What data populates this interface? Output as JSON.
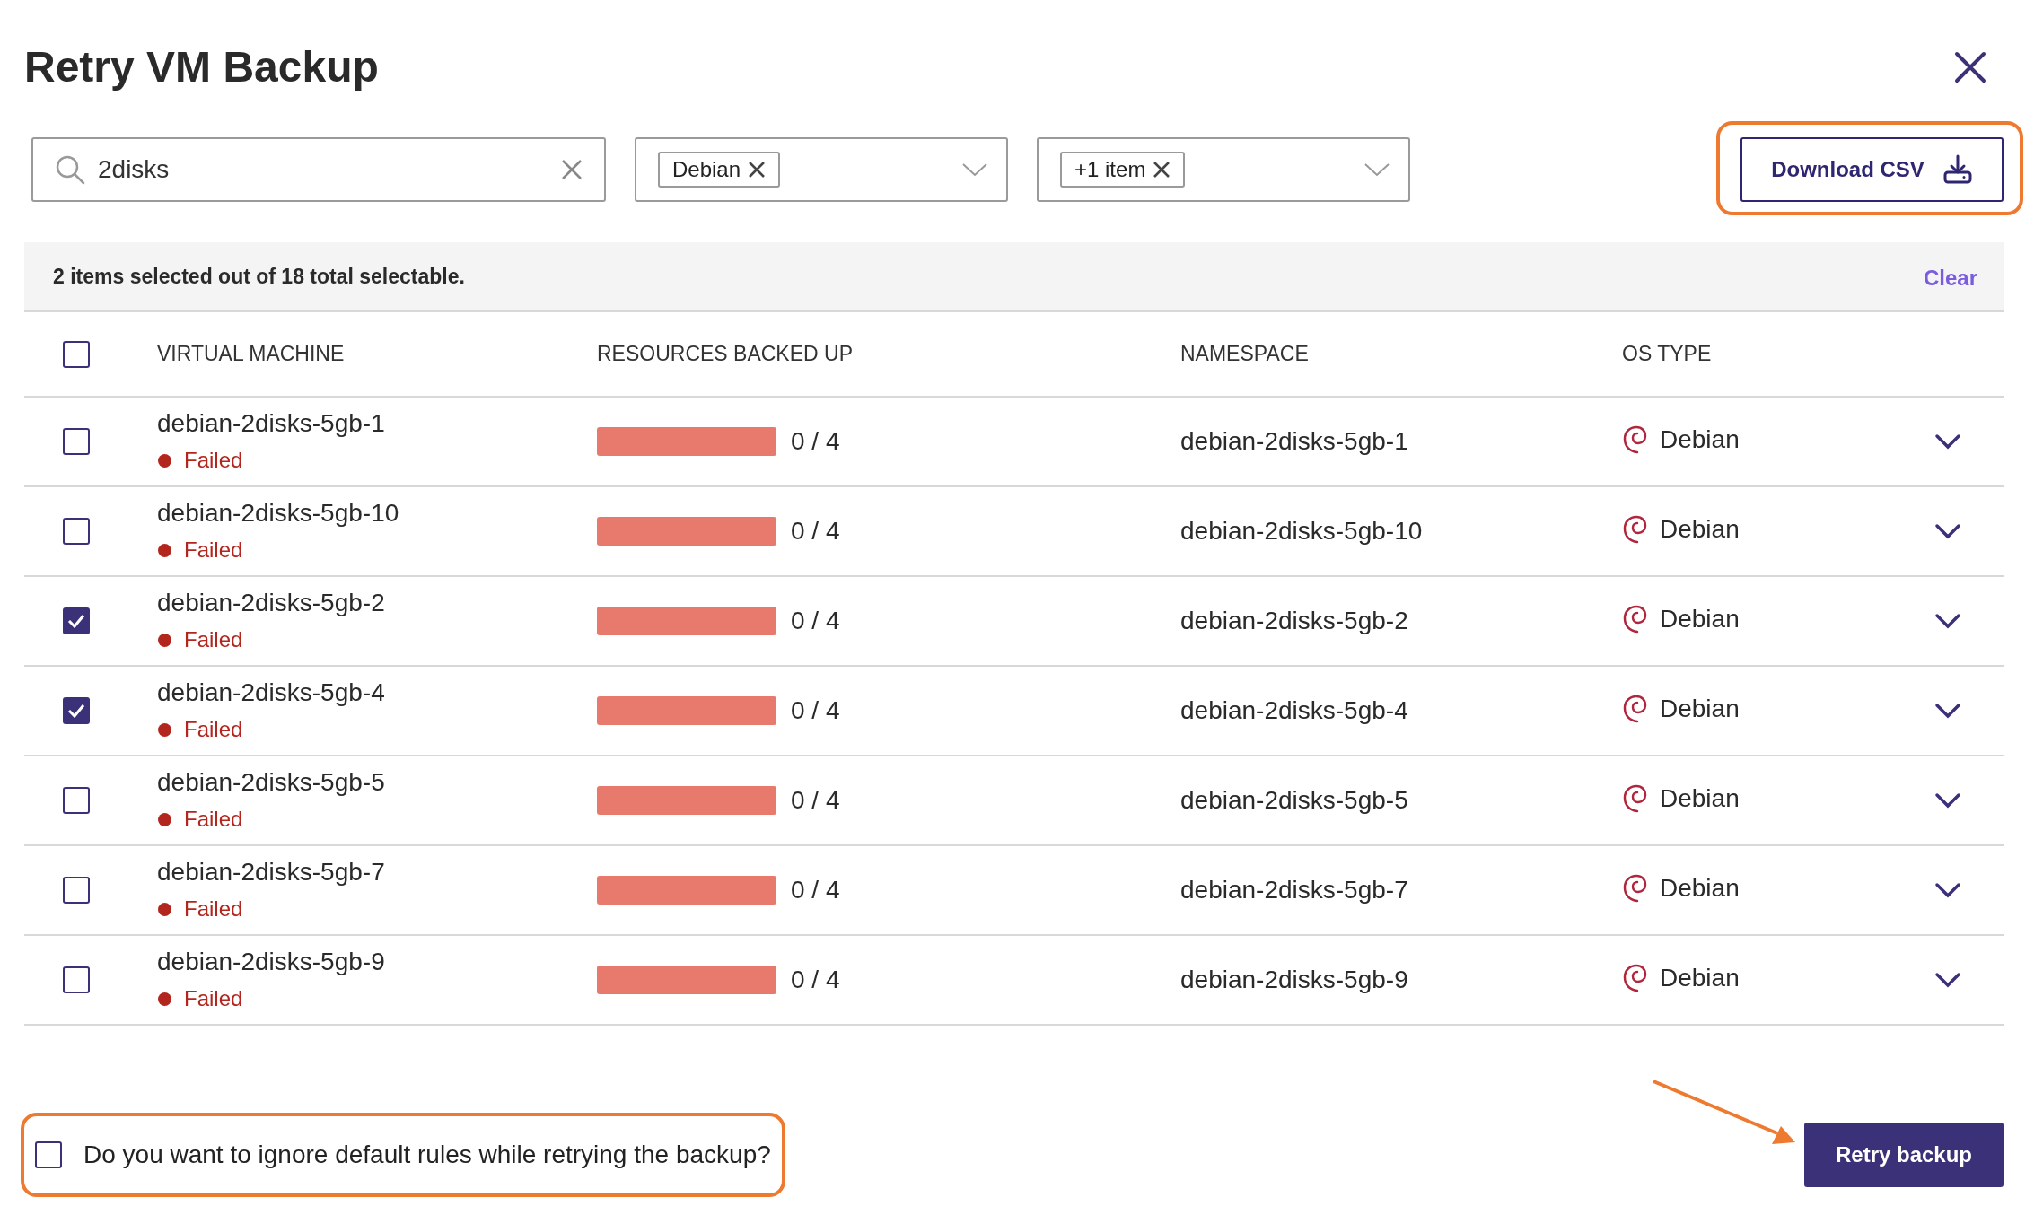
{
  "dialog": {
    "title": "Retry VM Backup"
  },
  "filters": {
    "search": {
      "value": "2disks"
    },
    "dropdowns": [
      {
        "chip": "Debian"
      },
      {
        "chip": "+1 item"
      }
    ]
  },
  "download_button": {
    "label": "Download CSV",
    "highlighted": true
  },
  "selection_bar": {
    "text": "2 items selected out of 18 total selectable.",
    "action": "Clear"
  },
  "table": {
    "select_all": {
      "checked": false
    },
    "columns": [
      "VIRTUAL MACHINE",
      "RESOURCES BACKED UP",
      "NAMESPACE",
      "OS TYPE"
    ],
    "rows": [
      {
        "selected": false,
        "name": "debian-2disks-5gb-1",
        "status": {
          "label": "Failed",
          "kind": "failed"
        },
        "resources": "0 / 4",
        "namespace": "debian-2disks-5gb-1",
        "os": "Debian"
      },
      {
        "selected": false,
        "name": "debian-2disks-5gb-10",
        "status": {
          "label": "Failed",
          "kind": "failed"
        },
        "resources": "0 / 4",
        "namespace": "debian-2disks-5gb-10",
        "os": "Debian"
      },
      {
        "selected": true,
        "name": "debian-2disks-5gb-2",
        "status": {
          "label": "Failed",
          "kind": "failed"
        },
        "resources": "0 / 4",
        "namespace": "debian-2disks-5gb-2",
        "os": "Debian"
      },
      {
        "selected": true,
        "name": "debian-2disks-5gb-4",
        "status": {
          "label": "Failed",
          "kind": "failed"
        },
        "resources": "0 / 4",
        "namespace": "debian-2disks-5gb-4",
        "os": "Debian"
      },
      {
        "selected": false,
        "name": "debian-2disks-5gb-5",
        "status": {
          "label": "Failed",
          "kind": "failed"
        },
        "resources": "0 / 4",
        "namespace": "debian-2disks-5gb-5",
        "os": "Debian"
      },
      {
        "selected": false,
        "name": "debian-2disks-5gb-7",
        "status": {
          "label": "Failed",
          "kind": "failed"
        },
        "resources": "0 / 4",
        "namespace": "debian-2disks-5gb-7",
        "os": "Debian"
      },
      {
        "selected": false,
        "name": "debian-2disks-5gb-9",
        "status": {
          "label": "Failed",
          "kind": "failed"
        },
        "resources": "0 / 4",
        "namespace": "debian-2disks-5gb-9",
        "os": "Debian"
      }
    ]
  },
  "ignore_rules": {
    "label": "Do you want to ignore default rules while retrying the backup?",
    "checked": false,
    "highlighted": true
  },
  "retry_button": {
    "label": "Retry backup",
    "arrow": true
  }
}
